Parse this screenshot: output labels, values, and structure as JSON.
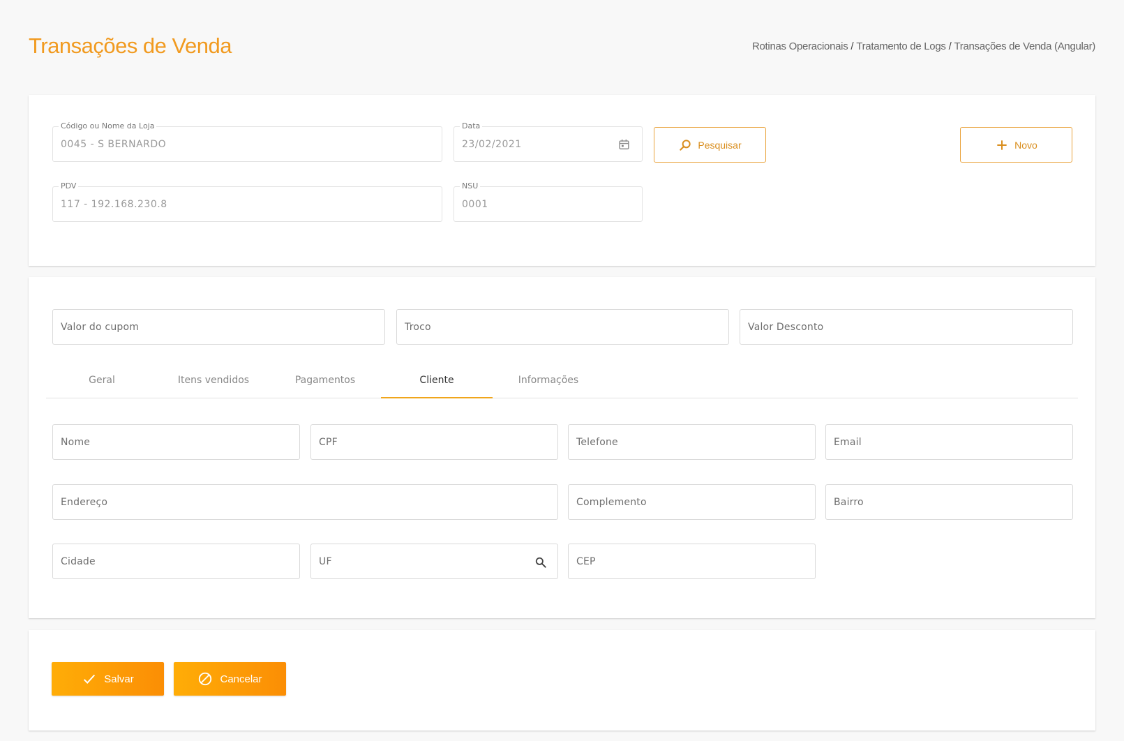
{
  "header": {
    "title": "Transações de Venda",
    "breadcrumb": [
      "Rotinas Operacionais",
      "Tratamento de Logs",
      "Transações de Venda (Angular)"
    ],
    "breadcrumb_separator": "/"
  },
  "filters": {
    "loja": {
      "label": "Código ou Nome da Loja",
      "value": "0045 - S BERNARDO"
    },
    "data": {
      "label": "Data",
      "value": "23/02/2021"
    },
    "pdv": {
      "label": "PDV",
      "value": "117 - 192.168.230.8"
    },
    "nsu": {
      "label": "NSU",
      "value": "0001"
    },
    "search_button": "Pesquisar",
    "new_button": "Novo"
  },
  "totals": {
    "valor_cupom": "Valor do cupom",
    "troco": "Troco",
    "valor_desconto": "Valor Desconto"
  },
  "tabs": [
    {
      "label": "Geral",
      "active": false
    },
    {
      "label": "Itens vendidos",
      "active": false
    },
    {
      "label": "Pagamentos",
      "active": false
    },
    {
      "label": "Cliente",
      "active": true
    },
    {
      "label": "Informações",
      "active": false
    }
  ],
  "cliente": {
    "nome": "Nome",
    "cpf": "CPF",
    "telefone": "Telefone",
    "email": "Email",
    "endereco": "Endereço",
    "complemento": "Complemento",
    "bairro": "Bairro",
    "cidade": "Cidade",
    "uf": "UF",
    "cep": "CEP"
  },
  "actions": {
    "save": "Salvar",
    "cancel": "Cancelar"
  },
  "colors": {
    "accent": "#f19a1f",
    "button_gradient_start": "#ffad07",
    "button_gradient_end": "#fb8e05",
    "tab_indicator": "#f0a51c"
  },
  "icons": {
    "search_button_icon": "magnifier-icon",
    "new_button_icon": "plus-icon",
    "date_icon": "calendar-icon",
    "uf_icon": "search-icon",
    "save_icon": "check-icon",
    "cancel_icon": "block-icon"
  }
}
